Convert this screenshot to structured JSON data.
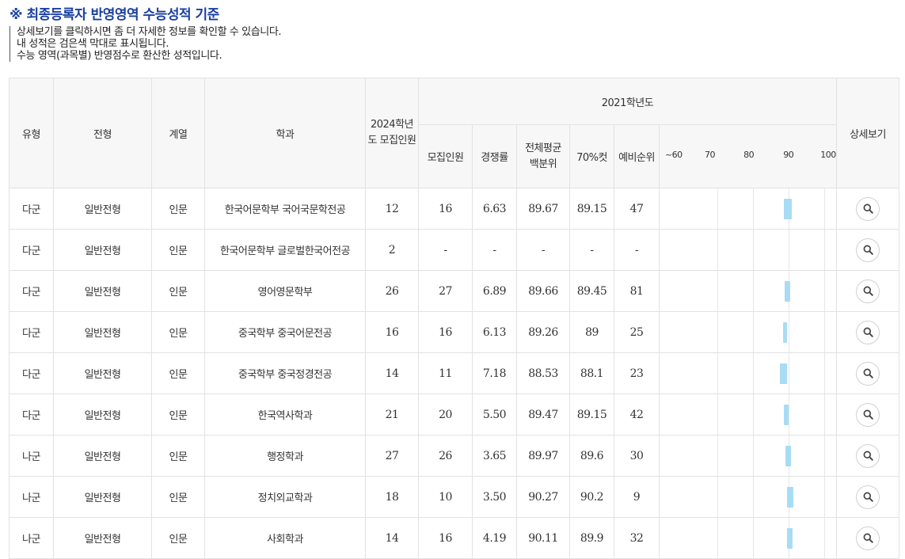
{
  "page": {
    "title": "※ 최종등록자 반영영역 수능성적 기준",
    "notes": [
      "상세보기를 클릭하시면 좀 더 자세한 정보를 확인할 수 있습니다.",
      "내 성적은 검은색 막대로 표시됩니다.",
      "수능 영역(과목별) 반영점수로 환산한 성적입니다."
    ]
  },
  "table": {
    "headers": {
      "type": "유형",
      "admission": "전형",
      "track": "계열",
      "dept": "학과",
      "recruit_2024": "2024학년도 모집인원",
      "year_group": "2021학년도",
      "recruit": "모집인원",
      "competition": "경쟁률",
      "avg_percentile": "전체평균 백분위",
      "cut70": "70%컷",
      "waitlist": "예비순위",
      "detail": "상세보기"
    },
    "scale_labels": [
      "~60",
      "70",
      "80",
      "90",
      "100"
    ],
    "rows": [
      {
        "type": "다군",
        "admission": "일반전형",
        "track": "인문",
        "dept": "한국어문학부 국어국문학전공",
        "recruit_2024": "12",
        "recruit": "16",
        "competition": "6.63",
        "avg": "89.67",
        "cut70": "89.15",
        "waitlist": "47",
        "bar": {
          "from": 89.15,
          "to": 91.5
        }
      },
      {
        "type": "다군",
        "admission": "일반전형",
        "track": "인문",
        "dept": "한국어문학부 글로벌한국어전공",
        "recruit_2024": "2",
        "recruit": "-",
        "competition": "-",
        "avg": "-",
        "cut70": "-",
        "waitlist": "-",
        "bar": null
      },
      {
        "type": "다군",
        "admission": "일반전형",
        "track": "인문",
        "dept": "영어영문학부",
        "recruit_2024": "26",
        "recruit": "27",
        "competition": "6.89",
        "avg": "89.66",
        "cut70": "89.45",
        "waitlist": "81",
        "bar": {
          "from": 89.45,
          "to": 91.0
        }
      },
      {
        "type": "다군",
        "admission": "일반전형",
        "track": "인문",
        "dept": "중국학부 중국어문전공",
        "recruit_2024": "16",
        "recruit": "16",
        "competition": "6.13",
        "avg": "89.26",
        "cut70": "89",
        "waitlist": "25",
        "bar": {
          "from": 89.0,
          "to": 90.0
        }
      },
      {
        "type": "다군",
        "admission": "일반전형",
        "track": "인문",
        "dept": "중국학부 중국정경전공",
        "recruit_2024": "14",
        "recruit": "11",
        "competition": "7.18",
        "avg": "88.53",
        "cut70": "88.1",
        "waitlist": "23",
        "bar": {
          "from": 88.1,
          "to": 90.0
        }
      },
      {
        "type": "다군",
        "admission": "일반전형",
        "track": "인문",
        "dept": "한국역사학과",
        "recruit_2024": "21",
        "recruit": "20",
        "competition": "5.50",
        "avg": "89.47",
        "cut70": "89.15",
        "waitlist": "42",
        "bar": {
          "from": 89.15,
          "to": 90.5
        }
      },
      {
        "type": "나군",
        "admission": "일반전형",
        "track": "인문",
        "dept": "행정학과",
        "recruit_2024": "27",
        "recruit": "26",
        "competition": "3.65",
        "avg": "89.97",
        "cut70": "89.6",
        "waitlist": "30",
        "bar": {
          "from": 89.6,
          "to": 91.3
        }
      },
      {
        "type": "나군",
        "admission": "일반전형",
        "track": "인문",
        "dept": "정치외교학과",
        "recruit_2024": "18",
        "recruit": "10",
        "competition": "3.50",
        "avg": "90.27",
        "cut70": "90.2",
        "waitlist": "9",
        "bar": {
          "from": 90.0,
          "to": 92.0
        }
      },
      {
        "type": "나군",
        "admission": "일반전형",
        "track": "인문",
        "dept": "사회학과",
        "recruit_2024": "14",
        "recruit": "16",
        "competition": "4.19",
        "avg": "90.11",
        "cut70": "89.9",
        "waitlist": "32",
        "bar": {
          "from": 90.0,
          "to": 91.6
        }
      }
    ]
  },
  "colors": {
    "title": "#1a3fa0",
    "bar": "#a8dcf4",
    "header_bg": "#f7f7f7"
  },
  "icons": {
    "detail": "search-icon"
  }
}
